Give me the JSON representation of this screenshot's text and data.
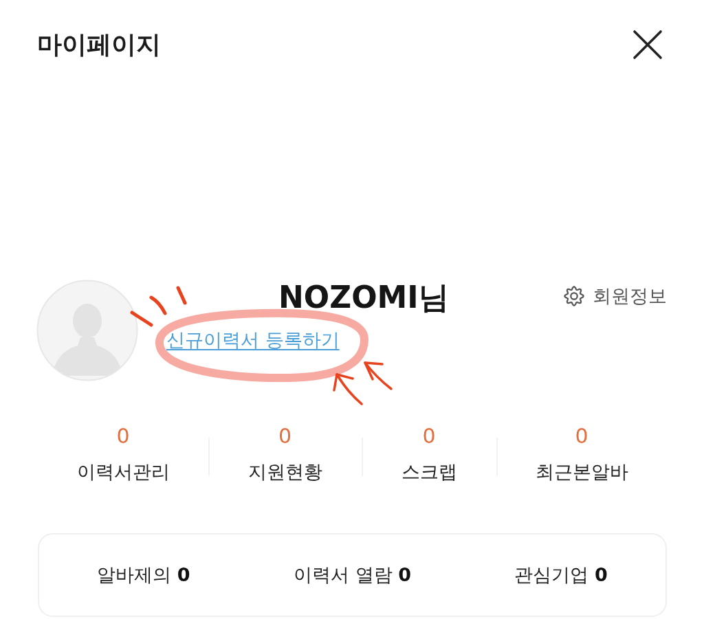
{
  "header": {
    "title": "마이페이지"
  },
  "profile": {
    "name": "NOZOMI님",
    "settings_label": "회원정보",
    "resume_link": "신규이력서 등록하기"
  },
  "stats": [
    {
      "value": "0",
      "label": "이력서관리"
    },
    {
      "value": "0",
      "label": "지원현황"
    },
    {
      "value": "0",
      "label": "스크랩"
    },
    {
      "value": "0",
      "label": "최근본알바"
    }
  ],
  "summary": [
    "알바제의 **0**",
    "이력서 열람 **0**",
    "관심기업 **0**"
  ]
}
